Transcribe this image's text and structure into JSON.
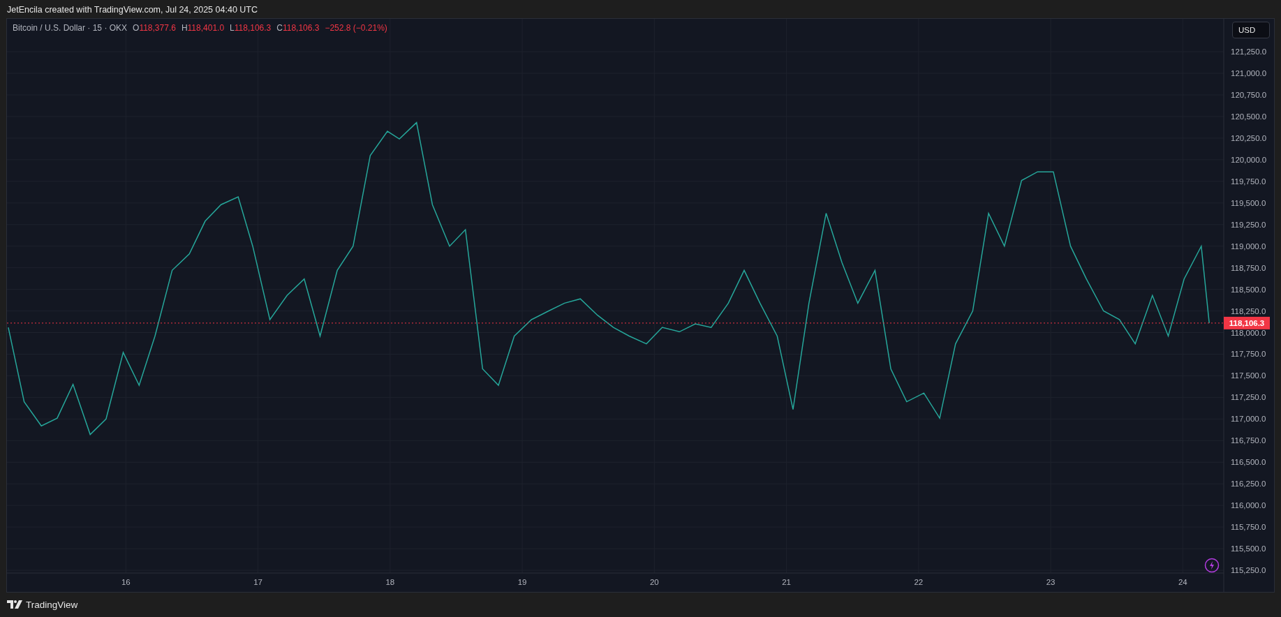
{
  "header": {
    "caption": "JetEncila created with TradingView.com, Jul 24, 2025 04:40 UTC"
  },
  "legend": {
    "symbol": "Bitcoin / U.S. Dollar · 15 · OKX",
    "color": "#f23645",
    "ohlc": [
      {
        "label": "O",
        "value": "118,377.6"
      },
      {
        "label": "H",
        "value": "118,401.0"
      },
      {
        "label": "L",
        "value": "118,106.3"
      },
      {
        "label": "C",
        "value": "118,106.3"
      }
    ],
    "change": "−252.8 (−0.21%)"
  },
  "currency_button": "USD",
  "last_price": {
    "label": "118,106.3",
    "color": "#f23645"
  },
  "chart": {
    "chart_data": {
      "type": "line",
      "grid": true,
      "x": [
        15.11,
        15.23,
        15.36,
        15.48,
        15.6,
        15.73,
        15.85,
        15.98,
        16.1,
        16.22,
        16.35,
        16.48,
        16.6,
        16.72,
        16.85,
        16.96,
        17.09,
        17.22,
        17.35,
        17.47,
        17.6,
        17.72,
        17.85,
        17.98,
        18.07,
        18.2,
        18.32,
        18.45,
        18.57,
        18.7,
        18.82,
        18.94,
        19.07,
        19.2,
        19.32,
        19.44,
        19.57,
        19.69,
        19.81,
        19.94,
        20.06,
        20.19,
        20.31,
        20.43,
        20.56,
        20.68,
        20.8,
        20.93,
        21.05,
        21.17,
        21.3,
        21.42,
        21.54,
        21.67,
        21.79,
        21.91,
        22.04,
        22.16,
        22.28,
        22.41,
        22.53,
        22.65,
        22.78,
        22.9,
        23.02,
        23.15,
        23.27,
        23.4,
        23.52,
        23.64,
        23.77,
        23.89,
        24.01,
        24.14,
        24.2
      ],
      "series": [
        {
          "color": "#26a69a",
          "values": [
            118060,
            117200,
            116920,
            117010,
            117400,
            116820,
            117000,
            117770,
            117390,
            117960,
            118720,
            118910,
            119290,
            119480,
            119570,
            119000,
            118150,
            118430,
            118620,
            117960,
            118720,
            119000,
            120050,
            120330,
            120240,
            120430,
            119480,
            119000,
            119190,
            117580,
            117390,
            117960,
            118150,
            118250,
            118340,
            118390,
            118200,
            118060,
            117960,
            117870,
            118060,
            118010,
            118100,
            118060,
            118340,
            118720,
            118340,
            117960,
            117110,
            118340,
            119380,
            118810,
            118340,
            118720,
            117580,
            117200,
            117300,
            117010,
            117870,
            118250,
            119380,
            119000,
            119760,
            119860,
            119860,
            119000,
            118620,
            118250,
            118150,
            117870,
            118430,
            117960,
            118620,
            119000,
            118110
          ]
        }
      ],
      "xlim": [
        15.1,
        24.31
      ],
      "ylim": [
        115218,
        121630
      ],
      "xticks": [
        {
          "value": 16,
          "label": "16"
        },
        {
          "value": 17,
          "label": "17"
        },
        {
          "value": 18,
          "label": "18"
        },
        {
          "value": 19,
          "label": "19"
        },
        {
          "value": 20,
          "label": "20"
        },
        {
          "value": 21,
          "label": "21"
        },
        {
          "value": 22,
          "label": "22"
        },
        {
          "value": 23,
          "label": "23"
        },
        {
          "value": 24,
          "label": "24"
        }
      ],
      "yticks": [
        {
          "value": 115250,
          "label": "115,250.0"
        },
        {
          "value": 115500,
          "label": "115,500.0"
        },
        {
          "value": 115750,
          "label": "115,750.0"
        },
        {
          "value": 116000,
          "label": "116,000.0"
        },
        {
          "value": 116250,
          "label": "116,250.0"
        },
        {
          "value": 116500,
          "label": "116,500.0"
        },
        {
          "value": 116750,
          "label": "116,750.0"
        },
        {
          "value": 117000,
          "label": "117,000.0"
        },
        {
          "value": 117250,
          "label": "117,250.0"
        },
        {
          "value": 117500,
          "label": "117,500.0"
        },
        {
          "value": 117750,
          "label": "117,750.0"
        },
        {
          "value": 118000,
          "label": "118,000.0"
        },
        {
          "value": 118250,
          "label": "118,250.0"
        },
        {
          "value": 118500,
          "label": "118,500.0"
        },
        {
          "value": 118750,
          "label": "118,750.0"
        },
        {
          "value": 119000,
          "label": "119,000.0"
        },
        {
          "value": 119250,
          "label": "119,250.0"
        },
        {
          "value": 119500,
          "label": "119,500.0"
        },
        {
          "value": 119750,
          "label": "119,750.0"
        },
        {
          "value": 120000,
          "label": "120,000.0"
        },
        {
          "value": 120250,
          "label": "120,250.0"
        },
        {
          "value": 120500,
          "label": "120,500.0"
        },
        {
          "value": 120750,
          "label": "120,750.0"
        },
        {
          "value": 121000,
          "label": "121,000.0"
        },
        {
          "value": 121250,
          "label": "121,250.0"
        }
      ]
    }
  },
  "footer": {
    "brand": "TradingView"
  }
}
